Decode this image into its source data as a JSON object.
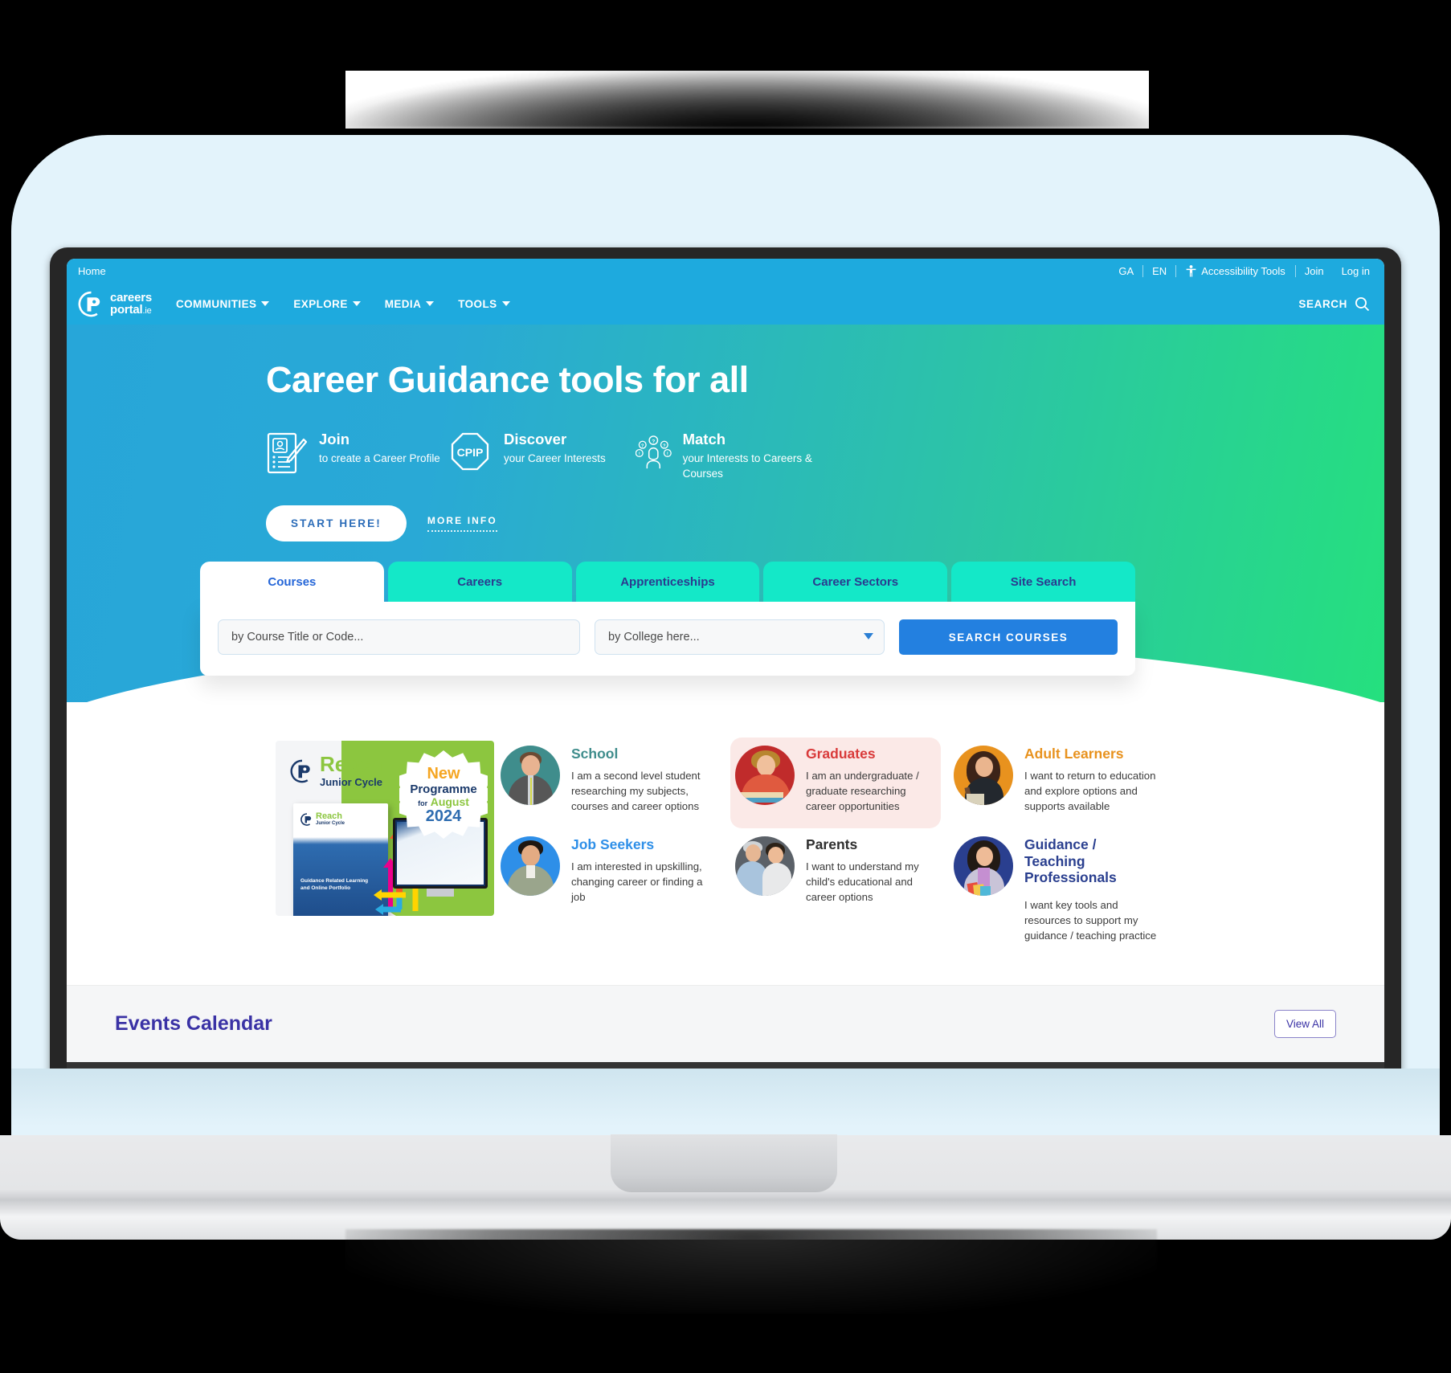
{
  "topbar": {
    "home_label": "Home",
    "lang_ga": "GA",
    "lang_en": "EN",
    "accessibility_label": "Accessibility Tools",
    "join_label": "Join",
    "login_label": "Log in"
  },
  "nav": {
    "logo_line1": "careers",
    "logo_line2": "portal",
    "logo_suffix": ".ie",
    "items": [
      {
        "label": "COMMUNITIES"
      },
      {
        "label": "EXPLORE"
      },
      {
        "label": "MEDIA"
      },
      {
        "label": "TOOLS"
      }
    ],
    "search_label": "SEARCH"
  },
  "hero": {
    "title": "Career Guidance tools for all",
    "features": [
      {
        "icon": "clipboard-pencil-icon",
        "title": "Join",
        "desc": "to create a Career Profile"
      },
      {
        "icon": "cpip-octagon-icon",
        "title": "Discover",
        "desc": "your Career Interests"
      },
      {
        "icon": "person-questions-icon",
        "title": "Match",
        "desc": "your Interests to Careers & Courses"
      }
    ],
    "cta_primary": "START HERE!",
    "cta_secondary": "MORE INFO"
  },
  "search_panel": {
    "tabs": [
      {
        "label": "Courses",
        "active": true
      },
      {
        "label": "Careers",
        "active": false
      },
      {
        "label": "Apprenticeships",
        "active": false
      },
      {
        "label": "Career Sectors",
        "active": false
      },
      {
        "label": "Site Search",
        "active": false
      }
    ],
    "title_placeholder": "by Course Title or Code...",
    "title_value": "",
    "college_selected": "by College here...",
    "college_options": [
      "by College here..."
    ],
    "submit_label": "SEARCH COURSES"
  },
  "audience": {
    "cards": [
      {
        "name": "School",
        "color": "#3f8d8c",
        "desc": "I am a second level student researching my subjects, courses and career options",
        "highlight": false
      },
      {
        "name": "Graduates",
        "color": "#d93a3a",
        "desc": "I am an undergraduate / graduate researching career opportunities",
        "highlight": true
      },
      {
        "name": "Adult Learners",
        "color": "#e8921e",
        "desc": "I want to return to education and explore options and supports available",
        "highlight": false
      },
      {
        "name": "Job Seekers",
        "color": "#2e8fe8",
        "desc": "I am interested in upskilling, changing career or finding a job",
        "highlight": false
      },
      {
        "name": "Parents",
        "color": "#2e2e2e",
        "desc": "I want to understand my child's educational and career options",
        "highlight": false
      },
      {
        "name": "Guidance / Teaching Professionals",
        "color": "#2a3f8f",
        "desc": "I want key tools and resources to support my guidance / teaching practice",
        "highlight": false
      }
    ]
  },
  "promo": {
    "brand": "Reach",
    "subtitle": "Junior Cycle",
    "booklet_brand": "Reach",
    "booklet_subtitle": "Junior Cycle",
    "booklet_text": "Guidance Related Learning and Online Portfolio",
    "badge_new": "New",
    "badge_programme": "Programme",
    "badge_for": "for",
    "badge_month": "August",
    "badge_year": "2024"
  },
  "events": {
    "title": "Events Calendar",
    "view_all_label": "View All"
  },
  "colors": {
    "brand_blue": "#1eaade",
    "hero_green": "#25e07e",
    "tab_teal": "#14e8c8",
    "search_button": "#2380e0",
    "events_purple": "#3a32a5",
    "page_bg": "#e3f3fb"
  }
}
